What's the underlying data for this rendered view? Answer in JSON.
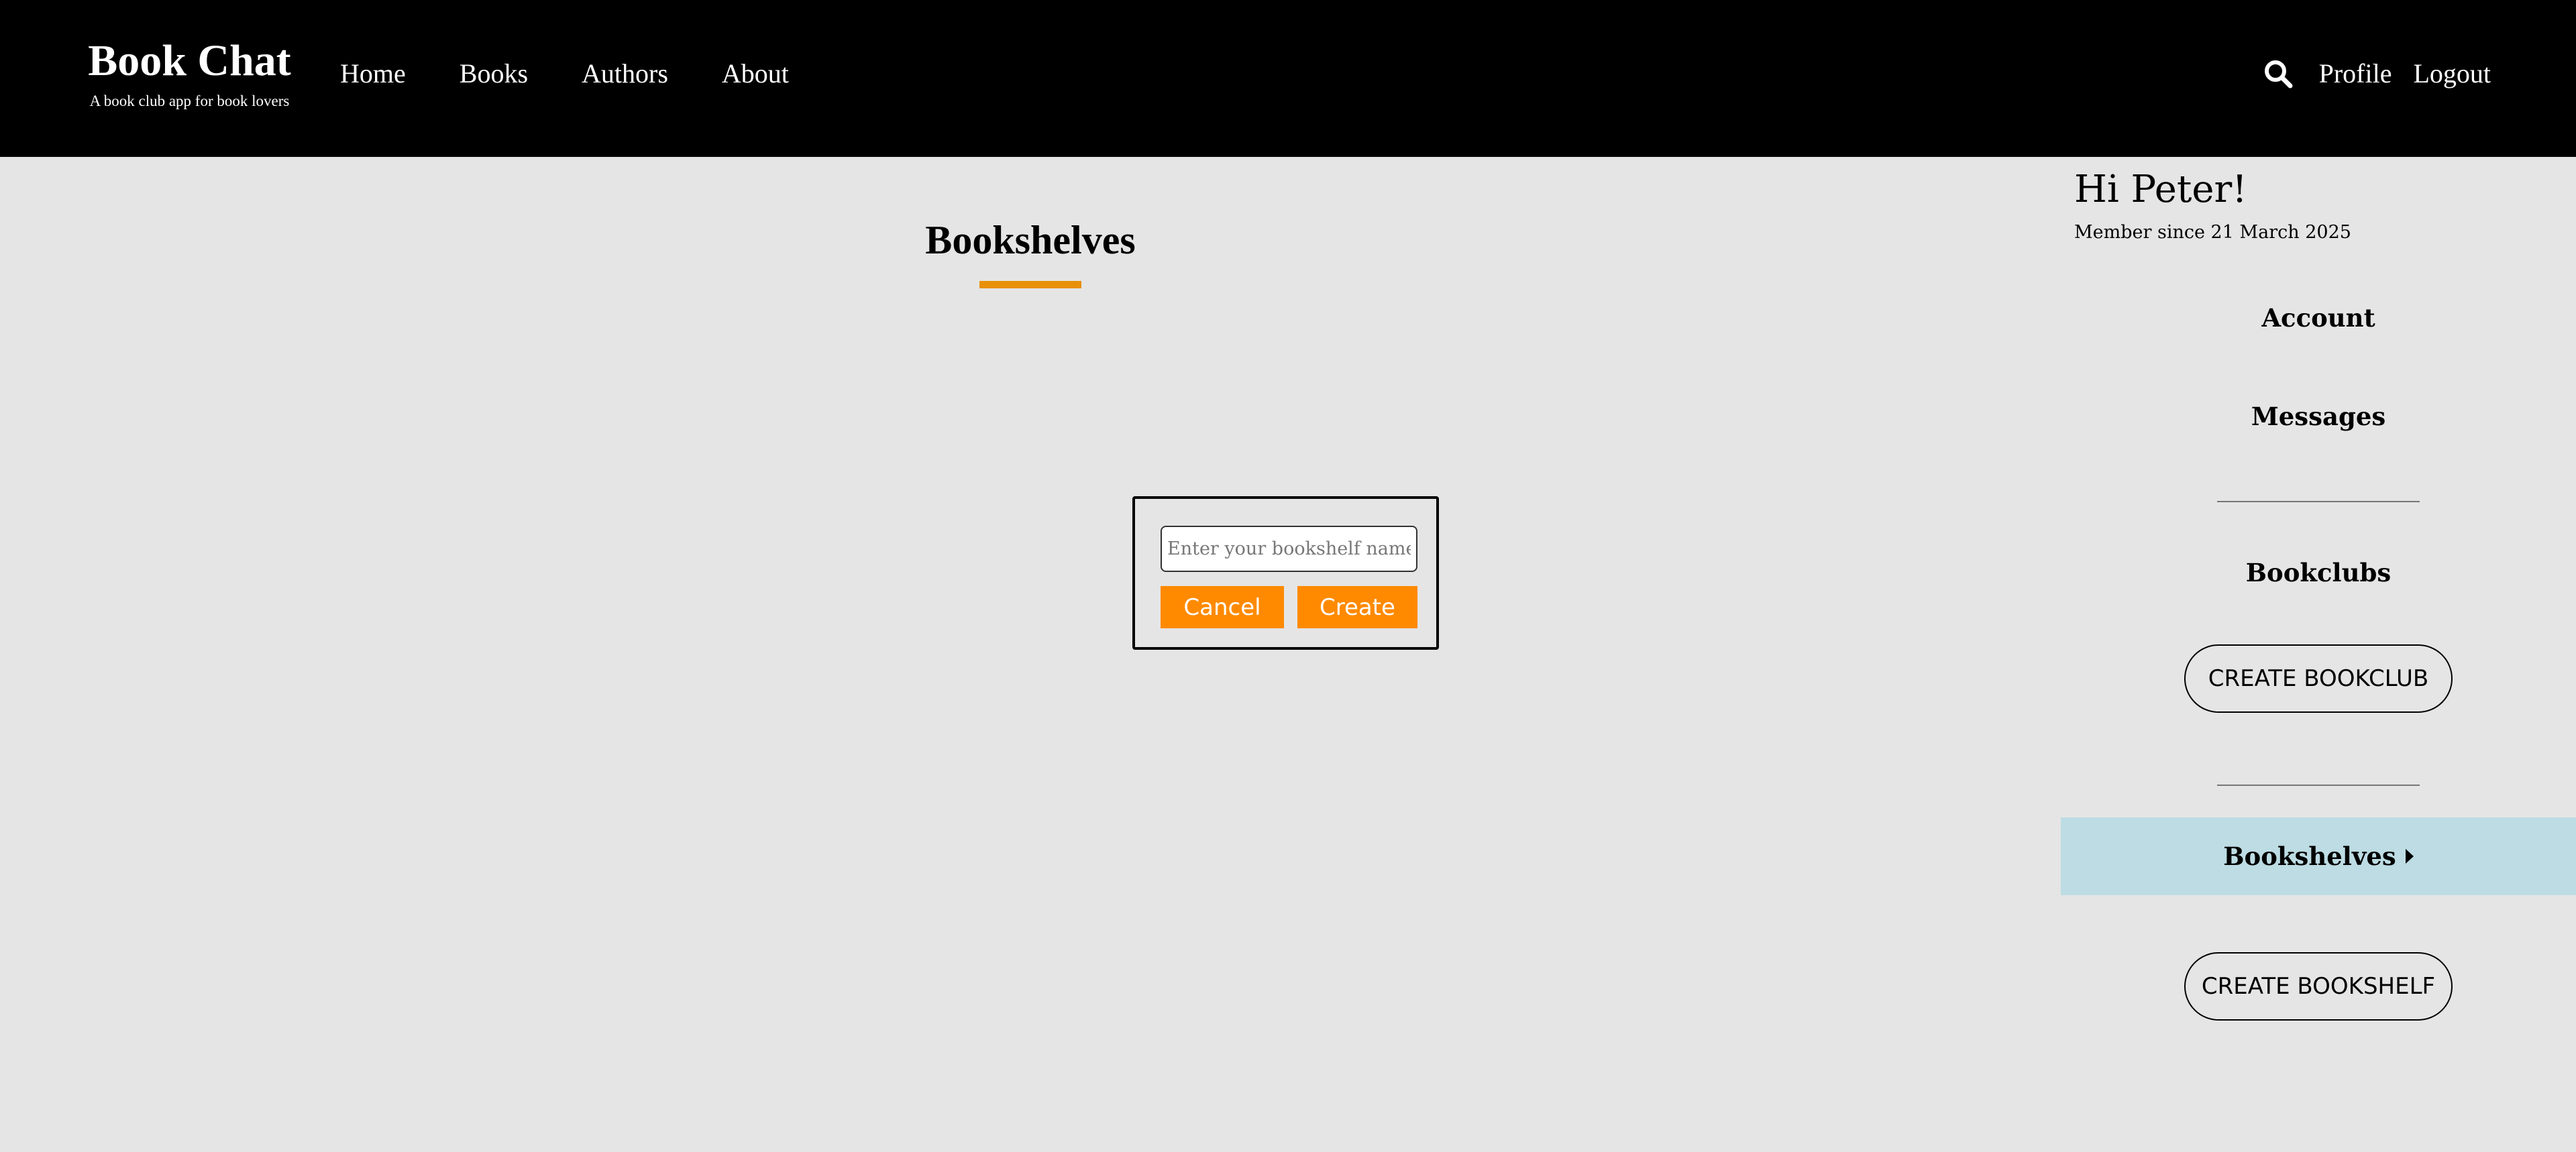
{
  "brand": {
    "title": "Book Chat",
    "tagline": "A book club app for book lovers"
  },
  "nav": {
    "items": [
      {
        "label": "Home"
      },
      {
        "label": "Books"
      },
      {
        "label": "Authors"
      },
      {
        "label": "About"
      }
    ]
  },
  "header_right": {
    "search_icon": "search-icon",
    "profile_label": "Profile",
    "logout_label": "Logout"
  },
  "main": {
    "title": "Bookshelves",
    "accent_color": "#e8900a"
  },
  "dialog": {
    "input_placeholder": "Enter your bookshelf name",
    "input_value": "",
    "cancel_label": "Cancel",
    "create_label": "Create",
    "button_color": "#ff8a00"
  },
  "sidebar": {
    "greeting": "Hi Peter!",
    "member_since": "Member since 21 March 2025",
    "account_label": "Account",
    "messages_label": "Messages",
    "bookclubs_heading": "Bookclubs",
    "create_bookclub_label": "CREATE BOOKCLUB",
    "active_item_label": "Bookshelves",
    "active_item_bg": "#bddce3",
    "create_bookshelf_label": "CREATE BOOKSHELF"
  }
}
